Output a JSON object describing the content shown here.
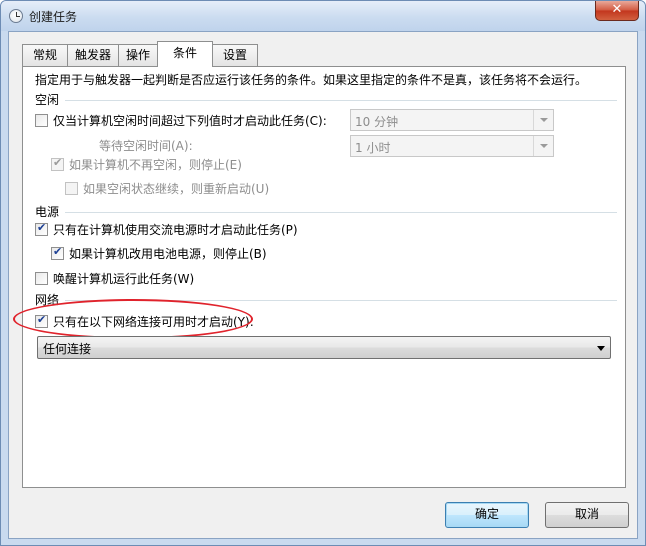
{
  "window": {
    "title": "创建任务",
    "close_glyph": "✕",
    "title_icon": "clock-icon"
  },
  "tabs": [
    {
      "label": "常规",
      "active": false
    },
    {
      "label": "触发器",
      "active": false
    },
    {
      "label": "操作",
      "active": false
    },
    {
      "label": "条件",
      "active": true
    },
    {
      "label": "设置",
      "active": false
    }
  ],
  "hint": "指定用于与触发器一起判断是否应运行该任务的条件。如果这里指定的条件不是真，该任务将不会运行。",
  "idle": {
    "section": "空闲",
    "start_if_idle": {
      "label": "仅当计算机空闲时间超过下列值时才启动此任务(C):",
      "checked": false
    },
    "idle_duration": "10 分钟",
    "wait_label": "等待空闲时间(A):",
    "wait_duration": "1 小时",
    "stop_if_not_idle": {
      "label": "如果计算机不再空闲，则停止(E)",
      "checked": true,
      "disabled": true
    },
    "restart_if_idle": {
      "label": "如果空闲状态继续，则重新启动(U)",
      "checked": false,
      "disabled": true
    }
  },
  "power": {
    "section": "电源",
    "ac_only": {
      "label": "只有在计算机使用交流电源时才启动此任务(P)",
      "checked": true
    },
    "stop_on_battery": {
      "label": "如果计算机改用电池电源，则停止(B)",
      "checked": true
    },
    "wake": {
      "label": "唤醒计算机运行此任务(W)",
      "checked": false
    }
  },
  "network": {
    "section": "网络",
    "only_if_network": {
      "label": "只有在以下网络连接可用时才启动(Y):",
      "checked": true
    },
    "connection": "任何连接"
  },
  "buttons": {
    "ok": "确定",
    "cancel": "取消"
  },
  "colors": {
    "annotation_ellipse": "#e0232c",
    "check_mark": "#1c3f94"
  }
}
